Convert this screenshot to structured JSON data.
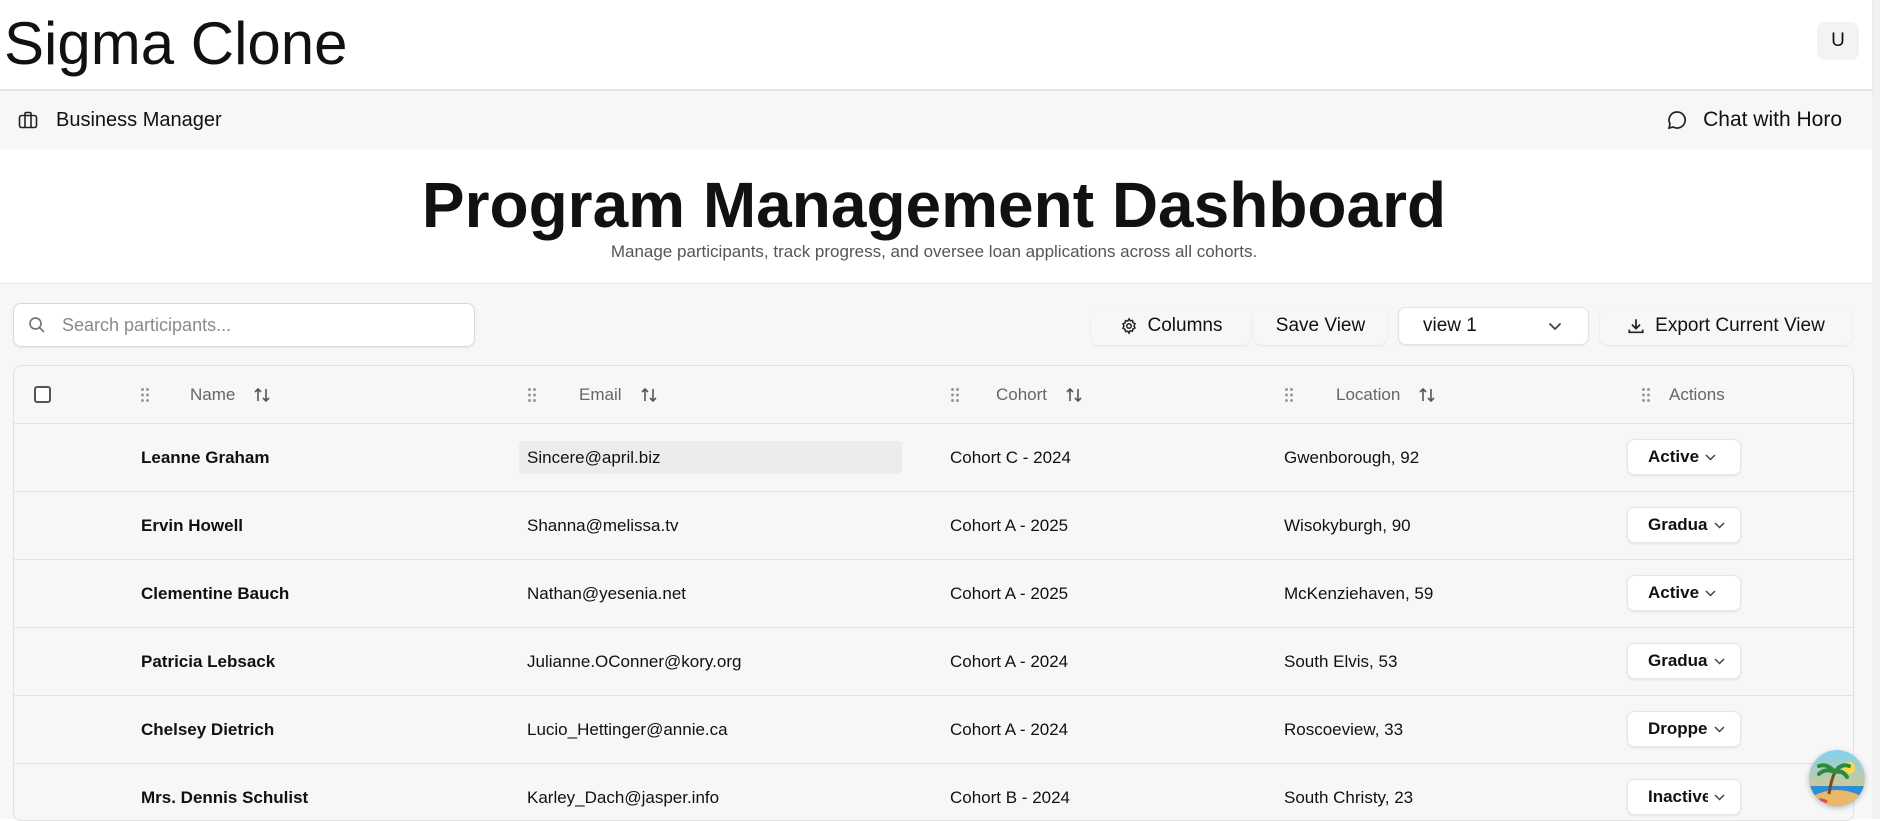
{
  "app": {
    "title": "Sigma Clone",
    "user_initial": "U"
  },
  "nav": {
    "business_manager": "Business Manager",
    "chat": "Chat with Horo"
  },
  "page": {
    "title": "Program Management Dashboard",
    "subtitle": "Manage participants, track progress, and oversee loan applications across all cohorts."
  },
  "toolbar": {
    "search_placeholder": "Search participants...",
    "columns_label": "Columns",
    "save_view_label": "Save View",
    "view_selected": "view 1",
    "export_label": "Export Current View"
  },
  "table": {
    "headers": {
      "name": "Name",
      "email": "Email",
      "cohort": "Cohort",
      "location": "Location",
      "actions": "Actions"
    },
    "rows": [
      {
        "name": "Leanne Graham",
        "email": "Sincere@april.biz",
        "cohort": "Cohort C - 2024",
        "location": "Gwenborough, 92",
        "status": "Active"
      },
      {
        "name": "Ervin Howell",
        "email": "Shanna@melissa.tv",
        "cohort": "Cohort A - 2025",
        "location": "Wisokyburgh, 90",
        "status": "Graduated"
      },
      {
        "name": "Clementine Bauch",
        "email": "Nathan@yesenia.net",
        "cohort": "Cohort A - 2025",
        "location": "McKenziehaven, 59",
        "status": "Active"
      },
      {
        "name": "Patricia Lebsack",
        "email": "Julianne.OConner@kory.org",
        "cohort": "Cohort A - 2024",
        "location": "South Elvis, 53",
        "status": "Graduated"
      },
      {
        "name": "Chelsey Dietrich",
        "email": "Lucio_Hettinger@annie.ca",
        "cohort": "Cohort A - 2024",
        "location": "Roscoeview, 33",
        "status": "Dropped"
      },
      {
        "name": "Mrs. Dennis Schulist",
        "email": "Karley_Dach@jasper.info",
        "cohort": "Cohort B - 2024",
        "location": "South Christy, 23",
        "status": "Inactive"
      }
    ]
  },
  "icons": {
    "briefcase": "briefcase-icon",
    "chat": "chat-bubble-icon",
    "search": "search-icon",
    "gear": "gear-icon",
    "download": "download-icon",
    "chevron": "chevron-down-icon",
    "drag": "drag-handle-icon",
    "sort": "sort-arrows-icon"
  }
}
